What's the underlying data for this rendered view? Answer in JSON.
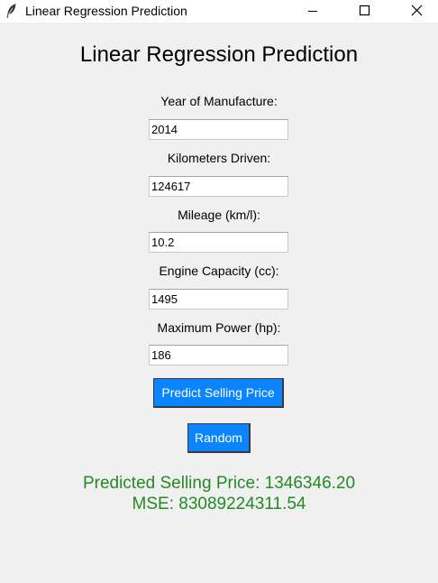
{
  "window": {
    "title": "Linear Regression Prediction",
    "icon": "feather-icon",
    "controls": [
      "minimize-icon",
      "maximize-icon",
      "close-icon"
    ]
  },
  "heading": "Linear Regression Prediction",
  "fields": [
    {
      "label": "Year of Manufacture:",
      "value": "2014"
    },
    {
      "label": "Kilometers Driven:",
      "value": "124617"
    },
    {
      "label": "Mileage (km/l):",
      "value": "10.2"
    },
    {
      "label": "Engine Capacity (cc):",
      "value": "1495"
    },
    {
      "label": "Maximum Power (hp):",
      "value": "186"
    }
  ],
  "buttons": {
    "predict": "Predict Selling Price",
    "random": "Random"
  },
  "result": {
    "prediction": "Predicted Selling Price: 1346346.20",
    "mse": "MSE: 83089224311.54"
  },
  "colors": {
    "button_bg": "#0a84ff",
    "button_text": "#ffffff",
    "result_text": "#228b22",
    "window_bg": "#f0f0f0"
  }
}
